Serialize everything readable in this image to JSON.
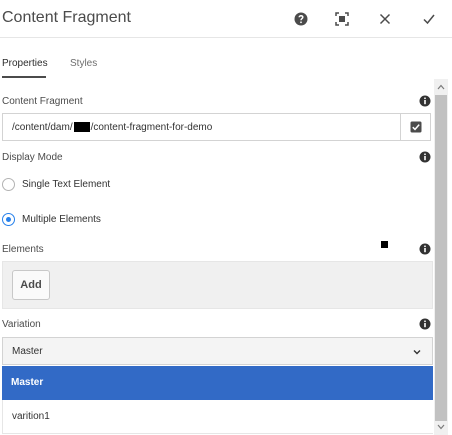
{
  "dialog": {
    "title": "Content Fragment",
    "header_icons": [
      "help-icon",
      "fullscreen-icon",
      "close-icon",
      "checkmark-icon"
    ]
  },
  "tabs": [
    {
      "label": "Properties",
      "active": true
    },
    {
      "label": "Styles",
      "active": false
    }
  ],
  "content_fragment": {
    "label": "Content Fragment",
    "path_prefix": "/content/dam/",
    "path_suffix": "/content-fragment-for-demo"
  },
  "display_mode": {
    "label": "Display Mode",
    "options": [
      {
        "label": "Single Text Element",
        "selected": false
      },
      {
        "label": "Multiple Elements",
        "selected": true
      }
    ]
  },
  "elements": {
    "label": "Elements",
    "add_label": "Add"
  },
  "variation": {
    "label": "Variation",
    "selected": "Master",
    "options": [
      "Master",
      "varition1"
    ]
  },
  "colors": {
    "accent": "#2680eb",
    "selected_option_bg": "#326ac6"
  }
}
